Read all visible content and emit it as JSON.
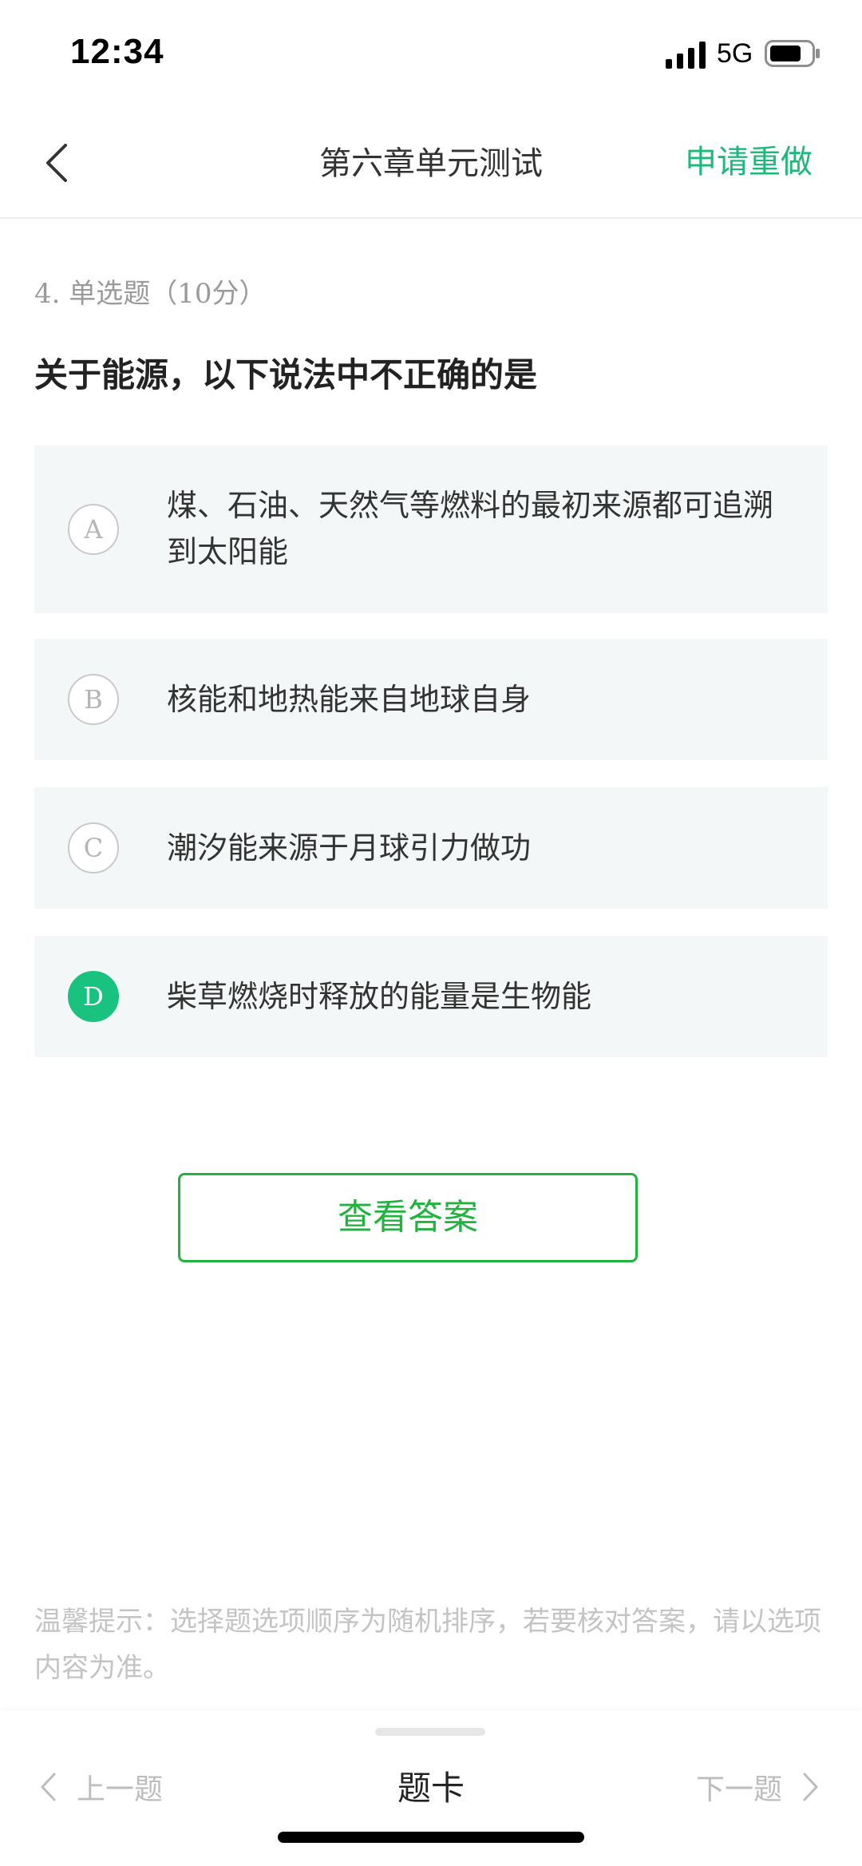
{
  "status_bar": {
    "time": "12:34",
    "network": "5G",
    "icons": [
      "signal-icon",
      "battery-icon"
    ]
  },
  "nav": {
    "back_icon": "chevron-left-icon",
    "title": "第六章单元测试",
    "redo_label": "申请重做"
  },
  "question": {
    "meta": "4. 单选题（10分）",
    "text": "关于能源，以下说法中不正确的是",
    "options": [
      {
        "letter": "A",
        "text": "煤、石油、天然气等燃料的最初来源都可追溯到太阳能",
        "selected": false
      },
      {
        "letter": "B",
        "text": "核能和地热能来自地球自身",
        "selected": false
      },
      {
        "letter": "C",
        "text": "潮汐能来源于月球引力做功",
        "selected": false
      },
      {
        "letter": "D",
        "text": "柴草燃烧时释放的能量是生物能",
        "selected": true
      }
    ]
  },
  "answer_button_label": "查看答案",
  "tip": "温馨提示：选择题选项顺序为随机排序，若要核对答案，请以选项内容为准。",
  "bottom_bar": {
    "prev_label": "上一题",
    "card_label": "题卡",
    "next_label": "下一题"
  },
  "colors": {
    "accent": "#1db97a",
    "selected_badge": "#19c27f",
    "answer_button": "#22b33f",
    "option_background": "#f4f7f7",
    "muted_text": "#bdbdbd"
  }
}
